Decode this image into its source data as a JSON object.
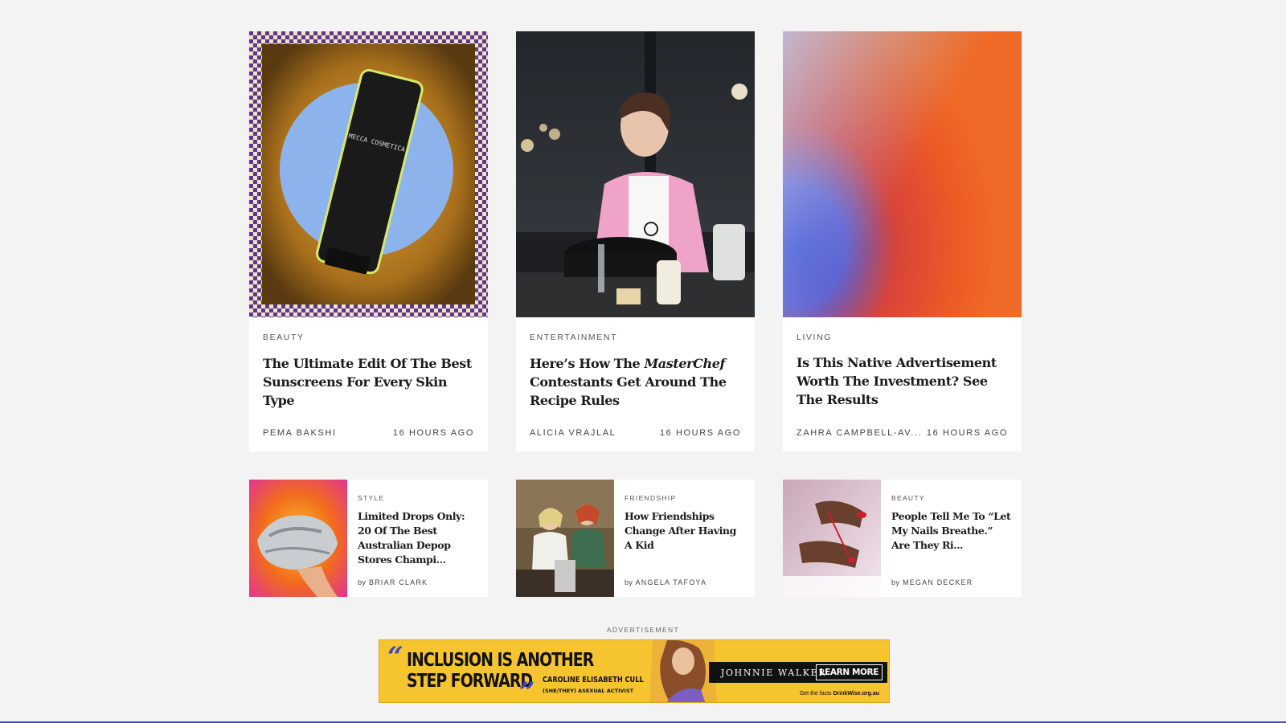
{
  "top_cards": [
    {
      "category": "BEAUTY",
      "title": "The Ultimate Edit Of The Best Sunscreens For Every Skin Type",
      "author": "PEMA BAKSHI",
      "time": "16 HOURS AGO",
      "product_text": "MECCA COSMETICA"
    },
    {
      "category": "ENTERTAINMENT",
      "title_pre": "Here’s How The ",
      "title_italic": "MasterChef",
      "title_post": " Contestants Get Around The Recipe Rules",
      "author": "ALICIA VRAJLAL",
      "time": "16 HOURS AGO"
    },
    {
      "category": "LIVING",
      "title": "Is This Native Advertisement Worth The Investment? See The Results",
      "author": "ZAHRA CAMPBELL-AV...",
      "time": "16 HOURS AGO"
    }
  ],
  "small_cards": [
    {
      "category": "STYLE",
      "title": "Limited Drops Only: 20 Of The Best Australian Depop Stores Champi...",
      "by": "by",
      "author": "BRIAR CLARK"
    },
    {
      "category": "FRIENDSHIP",
      "title": "How Friendships Change After Having A Kid",
      "by": "by",
      "author": "ANGELA TAFOYA"
    },
    {
      "category": "BEAUTY",
      "title": "People Tell Me To “Let My Nails Breathe.” Are They Ri...",
      "by": "by",
      "author": "MEGAN DECKER"
    }
  ],
  "ad": {
    "label": "ADVERTISEMENT",
    "headline_line1": "INCLUSION IS ANOTHER",
    "headline_line2": "STEP FORWARD",
    "person": "CAROLINE ELISABETH CULL",
    "pronouns": "(SHE/THEY)   ASEXUAL ACTIVIST",
    "brand": "JOHNNIE WALKER",
    "cta": "LEARN MORE",
    "footer_pre": "Get the facts ",
    "footer_link": "DrinkWise.org.au"
  },
  "colors": {
    "page_bg": "#f3f3f3",
    "ad_yellow": "#f6c431",
    "ad_blue": "#3a4ac4",
    "accent_line": "#3b52c0"
  }
}
